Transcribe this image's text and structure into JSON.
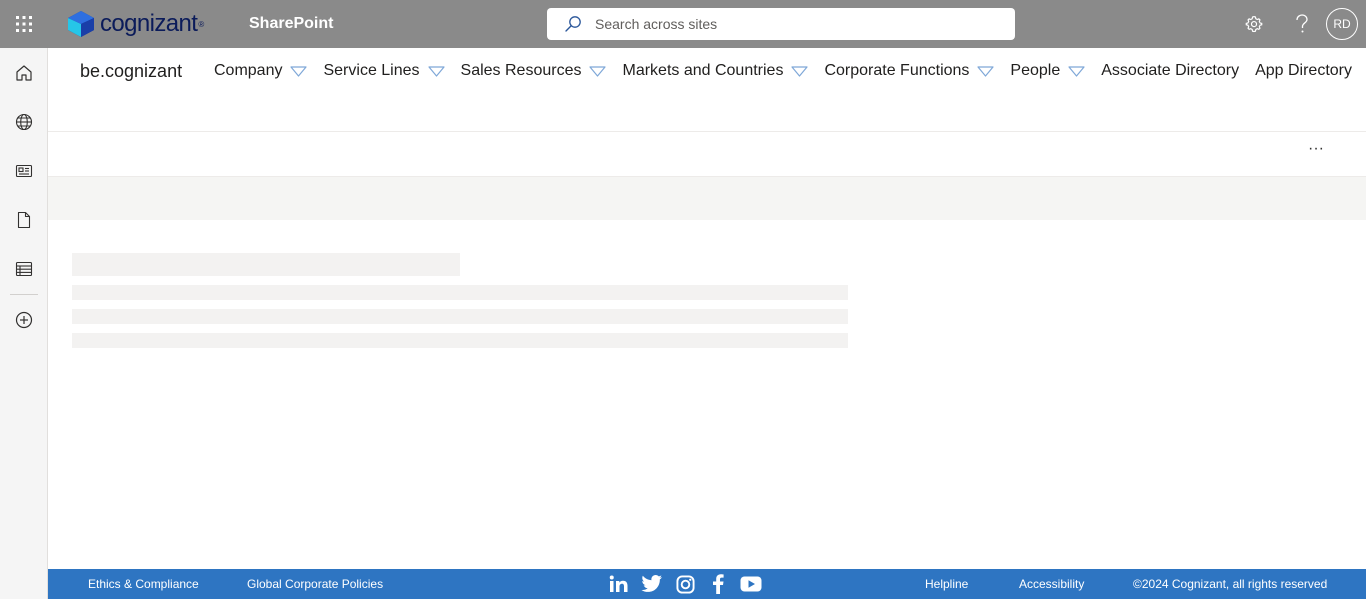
{
  "suitebar": {
    "brand_name": "cognizant",
    "app_name": "SharePoint",
    "search_placeholder": "Search across sites",
    "user_initials": "RD",
    "icons": [
      "waffle-icon",
      "search-icon",
      "settings-icon",
      "help-icon"
    ]
  },
  "appbar": {
    "items": [
      "home-icon",
      "globe-icon",
      "news-icon",
      "document-icon",
      "lists-icon",
      "add-icon"
    ]
  },
  "site": {
    "title": "be.cognizant",
    "nav": [
      {
        "label": "Company",
        "dropdown": true
      },
      {
        "label": "Service Lines",
        "dropdown": true
      },
      {
        "label": "Sales Resources",
        "dropdown": true
      },
      {
        "label": "Markets and Countries",
        "dropdown": true
      },
      {
        "label": "Corporate Functions",
        "dropdown": true
      },
      {
        "label": "People",
        "dropdown": true
      },
      {
        "label": "Associate Directory",
        "dropdown": false
      },
      {
        "label": "App Directory",
        "dropdown": false
      }
    ]
  },
  "commandbar": {
    "more_label": "···"
  },
  "footer": {
    "ethics": "Ethics & Compliance",
    "policies": "Global Corporate Policies",
    "helpline": "Helpline",
    "accessibility": "Accessibility",
    "copyright": "©2024 Cognizant, all rights reserved",
    "social": [
      "linkedin-icon",
      "twitter-icon",
      "instagram-icon",
      "facebook-icon",
      "youtube-icon"
    ]
  },
  "colors": {
    "suitebar": "#8a8a8a",
    "footer": "#2e75c2",
    "nav_chevron": "#7fa8d8",
    "shimmer": "#f3f2f1"
  }
}
